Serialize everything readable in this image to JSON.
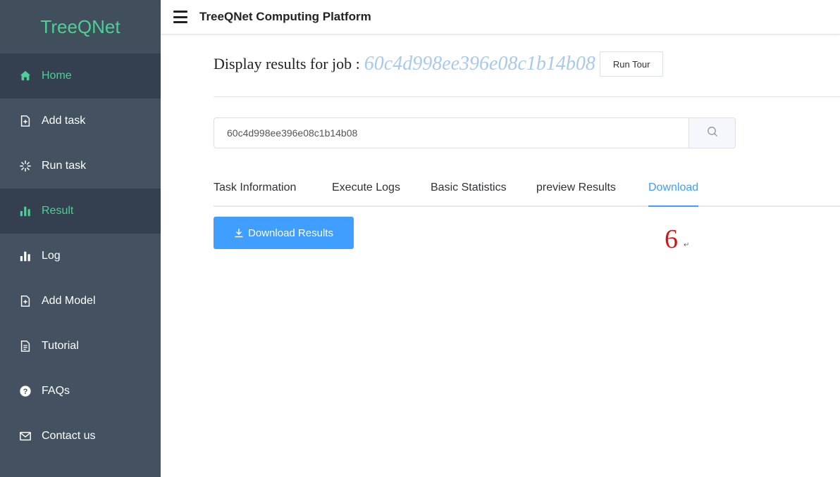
{
  "sidebar": {
    "brand": "TreeQNet",
    "items": [
      {
        "label": "Home",
        "icon": "home-icon"
      },
      {
        "label": "Add task",
        "icon": "file-plus-icon"
      },
      {
        "label": "Run task",
        "icon": "loading-icon"
      },
      {
        "label": "Result",
        "icon": "bar-chart-icon"
      },
      {
        "label": "Log",
        "icon": "bar-chart-icon"
      },
      {
        "label": "Add Model",
        "icon": "file-plus-icon"
      },
      {
        "label": "Tutorial",
        "icon": "document-icon"
      },
      {
        "label": "FAQs",
        "icon": "question-icon"
      },
      {
        "label": "Contact us",
        "icon": "mail-icon"
      }
    ],
    "active_color": "#4ecf95"
  },
  "header": {
    "title": "TreeQNet Computing Platform"
  },
  "main": {
    "job_label": "Display results for job :",
    "job_id": "60c4d998ee396e08c1b14b08",
    "tour_button": "Run Tour",
    "search_value": "60c4d998ee396e08c1b14b08",
    "tabs": [
      {
        "label": "Task Information"
      },
      {
        "label": "Execute Logs"
      },
      {
        "label": "Basic Statistics"
      },
      {
        "label": "preview Results"
      },
      {
        "label": "Download"
      }
    ],
    "active_tab": "Download",
    "download_button": "Download Results",
    "step_marker": "6",
    "return_mark": "↵"
  },
  "colors": {
    "sidebar_bg": "#435161",
    "accent_blue": "#409eff",
    "marker_red": "#d41616"
  }
}
